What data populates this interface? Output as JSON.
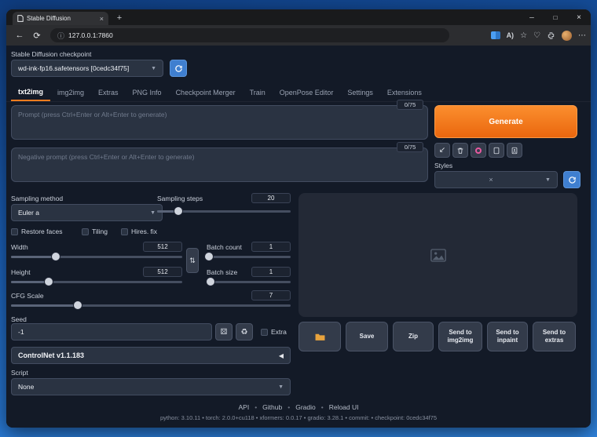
{
  "browser": {
    "tab_title": "Stable Diffusion",
    "url": "127.0.0.1:7860"
  },
  "app": {
    "checkpoint": {
      "label": "Stable Diffusion checkpoint",
      "value": "wd-ink-fp16.safetensors [0cedc34f75]"
    },
    "tabs": [
      "txt2img",
      "img2img",
      "Extras",
      "PNG Info",
      "Checkpoint Merger",
      "Train",
      "OpenPose Editor",
      "Settings",
      "Extensions"
    ],
    "prompt": {
      "placeholder": "Prompt (press Ctrl+Enter or Alt+Enter to generate)",
      "counter": "0/75"
    },
    "negative_prompt": {
      "placeholder": "Negative prompt (press Ctrl+Enter or Alt+Enter to generate)",
      "counter": "0/75"
    },
    "generate_label": "Generate",
    "styles_label": "Styles",
    "params": {
      "sampling_method_label": "Sampling method",
      "sampling_method": "Euler a",
      "sampling_steps_label": "Sampling steps",
      "sampling_steps": "20",
      "restore_faces_label": "Restore faces",
      "tiling_label": "Tiling",
      "hires_label": "Hires. fix",
      "width_label": "Width",
      "width": "512",
      "height_label": "Height",
      "height": "512",
      "batch_count_label": "Batch count",
      "batch_count": "1",
      "batch_size_label": "Batch size",
      "batch_size": "1",
      "cfg_label": "CFG Scale",
      "cfg": "7",
      "seed_label": "Seed",
      "seed": "-1",
      "extra_label": "Extra",
      "controlnet_label": "ControlNet v1.1.183",
      "script_label": "Script",
      "script_value": "None"
    },
    "sliders": {
      "steps_pct": 16,
      "width_pct": 26,
      "height_pct": 22,
      "batch_count_pct": 3,
      "batch_size_pct": 5,
      "cfg_pct": 24
    },
    "output_buttons": {
      "save": "Save",
      "zip": "Zip",
      "send_img2img": "Send to img2img",
      "send_inpaint": "Send to inpaint",
      "send_extras": "Send to extras"
    },
    "footer": {
      "links": [
        "API",
        "Github",
        "Gradio",
        "Reload UI"
      ],
      "separator": "•",
      "version": "python: 3.10.11  •  torch: 2.0.0+cu118  •  xformers: 0.0.17  •  gradio: 3.28.1  •  commit:  •  checkpoint: 0cedc34f75"
    }
  }
}
